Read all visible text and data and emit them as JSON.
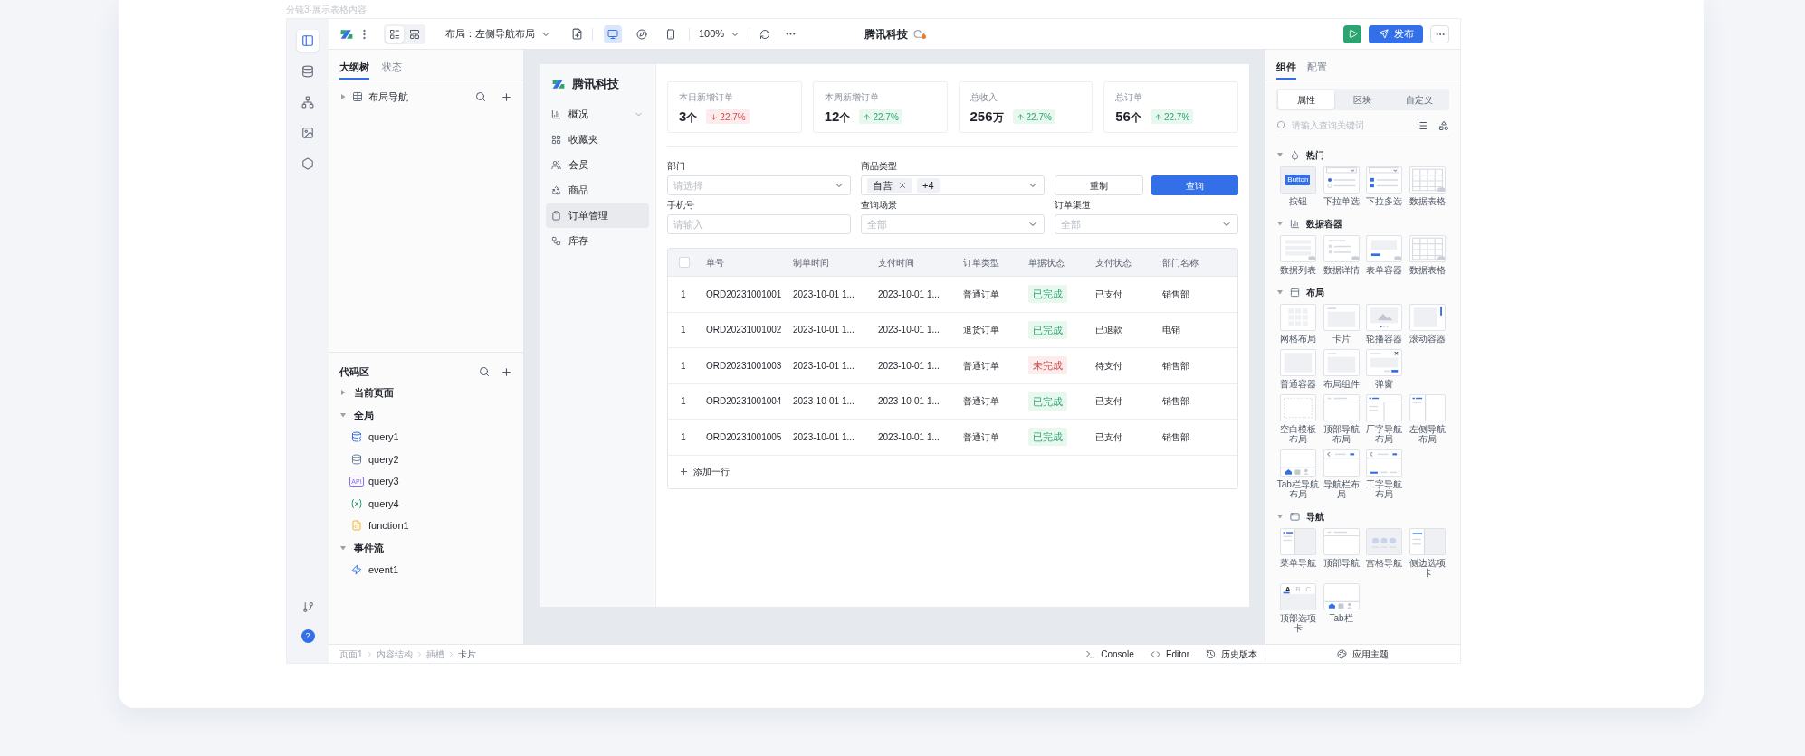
{
  "caption": "分镜3-展示表格内容",
  "toolbar": {
    "view_modes": [
      {
        "selected": true
      },
      {
        "selected": false
      }
    ],
    "layout_label": "布局：左侧导航布局",
    "devices": [
      {
        "selected": true
      },
      {
        "selected": false
      },
      {
        "selected": false
      }
    ],
    "zoom": "100%",
    "title": "腾讯科技",
    "unsaved": true,
    "publish": "发布"
  },
  "rail": {
    "items": [
      {
        "selected": true
      },
      {
        "selected": false
      },
      {
        "selected": false
      },
      {
        "selected": false
      },
      {
        "selected": false
      }
    ],
    "help": "?"
  },
  "left_panel": {
    "tabs": [
      {
        "label": "大纲树",
        "selected": true
      },
      {
        "label": "状态",
        "selected": false
      }
    ],
    "outline": [
      {
        "label": "布局导航",
        "expanded": false
      }
    ],
    "code_title": "代码区",
    "code_tree": [
      {
        "label": "当前页面",
        "expanded": false
      },
      {
        "label": "全局",
        "expanded": true,
        "children": [
          {
            "label": "query1",
            "kind": "database"
          },
          {
            "label": "query2",
            "kind": "database2"
          },
          {
            "label": "query3",
            "kind": "api",
            "badge": "API"
          },
          {
            "label": "query4",
            "kind": "variable"
          },
          {
            "label": "function1",
            "kind": "script"
          }
        ]
      },
      {
        "label": "事件流",
        "expanded": true,
        "children": [
          {
            "label": "event1",
            "kind": "event"
          }
        ]
      }
    ]
  },
  "breadcrumb": [
    "页面1",
    "内容结构",
    "插槽",
    "卡片"
  ],
  "bottom_tools": [
    "Console",
    "Editor",
    "历史版本"
  ],
  "theme_button": "应用主题",
  "preview": {
    "brand": "腾讯科技",
    "nav": [
      {
        "label": "概况",
        "kind": "group",
        "selected": false
      },
      {
        "label": "收藏夹",
        "kind": "link",
        "selected": false
      },
      {
        "label": "会员",
        "kind": "link",
        "selected": false
      },
      {
        "label": "商品",
        "kind": "link",
        "selected": false
      },
      {
        "label": "订单管理",
        "kind": "link",
        "selected": true
      },
      {
        "label": "库存",
        "kind": "link",
        "selected": false
      }
    ],
    "stats": [
      {
        "title": "本日新增订单",
        "value": "3",
        "unit": "个",
        "change": "22.7%",
        "kind": "down"
      },
      {
        "title": "本周新增订单",
        "value": "12",
        "unit": "个",
        "change": "22.7%",
        "kind": "up"
      },
      {
        "title": "总收入",
        "value": "256",
        "unit": "万",
        "change": "22.7%",
        "kind": "up"
      },
      {
        "title": "总订单",
        "value": "56",
        "unit": "个",
        "change": "22.7%",
        "kind": "up"
      }
    ],
    "filters": [
      {
        "label": "部门",
        "kind": "select",
        "placeholder": "请选择"
      },
      {
        "label": "商品类型",
        "kind": "multiselect",
        "tags": [
          "自营"
        ],
        "more": "+4"
      },
      {
        "label": "手机号",
        "kind": "input",
        "placeholder": "请输入"
      },
      {
        "label": "查询场景",
        "kind": "select",
        "placeholder": "全部"
      },
      {
        "label": "订单渠道",
        "kind": "select",
        "placeholder": "全部"
      }
    ],
    "reset": "重制",
    "query": "查询",
    "table": {
      "select_all": false,
      "columns": [
        "单号",
        "制单时间",
        "支付时间",
        "订单类型",
        "单据状态",
        "支付状态",
        "部门名称"
      ],
      "rows": [
        {
          "index": "1",
          "order_no": "ORD20231001001",
          "created": "2023-10-01 1...",
          "paid": "2023-10-01 1...",
          "type": "普通订单",
          "status": {
            "text": "已完成",
            "kind": "done"
          },
          "pay_status": "已支付",
          "dept": "销售部"
        },
        {
          "index": "1",
          "order_no": "ORD20231001002",
          "created": "2023-10-01 1...",
          "paid": "2023-10-01 1...",
          "type": "退货订单",
          "status": {
            "text": "已完成",
            "kind": "done"
          },
          "pay_status": "已退款",
          "dept": "电销"
        },
        {
          "index": "1",
          "order_no": "ORD20231001003",
          "created": "2023-10-01 1...",
          "paid": "2023-10-01 1...",
          "type": "普通订单",
          "status": {
            "text": "未完成",
            "kind": "pending"
          },
          "pay_status": "待支付",
          "dept": "销售部"
        },
        {
          "index": "1",
          "order_no": "ORD20231001004",
          "created": "2023-10-01 1...",
          "paid": "2023-10-01 1...",
          "type": "普通订单",
          "status": {
            "text": "已完成",
            "kind": "done"
          },
          "pay_status": "已支付",
          "dept": "销售部"
        },
        {
          "index": "1",
          "order_no": "ORD20231001005",
          "created": "2023-10-01 1...",
          "paid": "2023-10-01 1...",
          "type": "普通订单",
          "status": {
            "text": "已完成",
            "kind": "done"
          },
          "pay_status": "已支付",
          "dept": "销售部"
        }
      ]
    },
    "add_row": "添加一行"
  },
  "right_panel": {
    "tabs": [
      {
        "label": "组件",
        "selected": true
      },
      {
        "label": "配置",
        "selected": false
      }
    ],
    "segments": [
      {
        "label": "属性",
        "selected": true
      },
      {
        "label": "区块",
        "selected": false
      },
      {
        "label": "自定义",
        "selected": false
      }
    ],
    "search_placeholder": "请输入查询关键词",
    "groups": [
      {
        "title": "热门",
        "expanded": true,
        "rows": [
          [
            {
              "label": "按钮",
              "kind": "button",
              "thumb_labels": [
                "Button"
              ]
            },
            {
              "label": "下拉单选",
              "kind": "radio"
            },
            {
              "label": "下拉多选",
              "kind": "check"
            },
            {
              "label": "数据表格",
              "kind": "table"
            }
          ]
        ]
      },
      {
        "title": "数据容器",
        "expanded": true,
        "rows": [
          [
            {
              "label": "数据列表",
              "kind": "list"
            },
            {
              "label": "数据详情",
              "kind": "detail"
            },
            {
              "label": "表单容器",
              "kind": "form"
            },
            {
              "label": "数据表格",
              "kind": "table"
            }
          ]
        ]
      },
      {
        "title": "布局",
        "expanded": true,
        "rows": [
          [
            {
              "label": "网格布局",
              "kind": "grid"
            },
            {
              "label": "卡片",
              "kind": "card"
            },
            {
              "label": "轮播容器",
              "kind": "carousel"
            },
            {
              "label": "滚动容器",
              "kind": "scroll"
            }
          ],
          [
            {
              "label": "普通容器",
              "kind": "plain"
            },
            {
              "label": "布局组件",
              "kind": "card"
            },
            {
              "label": "弹窗",
              "kind": "modal"
            }
          ],
          [
            {
              "label": "空白模板布局",
              "kind": "blank"
            },
            {
              "label": "顶部导航布局",
              "kind": "topnav"
            },
            {
              "label": "厂字导航布局",
              "kind": "lnav"
            },
            {
              "label": "左侧导航布局",
              "kind": "sidenav"
            }
          ],
          [
            {
              "label": "Tab栏导航布局",
              "kind": "tabbar"
            },
            {
              "label": "导航栏布局",
              "kind": "navbar"
            },
            {
              "label": "工字导航布局",
              "kind": "gnav"
            }
          ]
        ]
      },
      {
        "title": "导航",
        "expanded": true,
        "rows": [
          [
            {
              "label": "菜单导航",
              "kind": "menu"
            },
            {
              "label": "顶部导航",
              "kind": "topnav"
            },
            {
              "label": "宫格导航",
              "kind": "gridnav"
            },
            {
              "label": "侧边选项卡",
              "kind": "sidetab"
            }
          ],
          [
            {
              "label": "顶部选项卡",
              "kind": "toptab",
              "thumb_labels": [
                "A",
                "B",
                "C"
              ]
            },
            {
              "label": "Tab栏",
              "kind": "tabbar"
            }
          ]
        ]
      }
    ]
  }
}
